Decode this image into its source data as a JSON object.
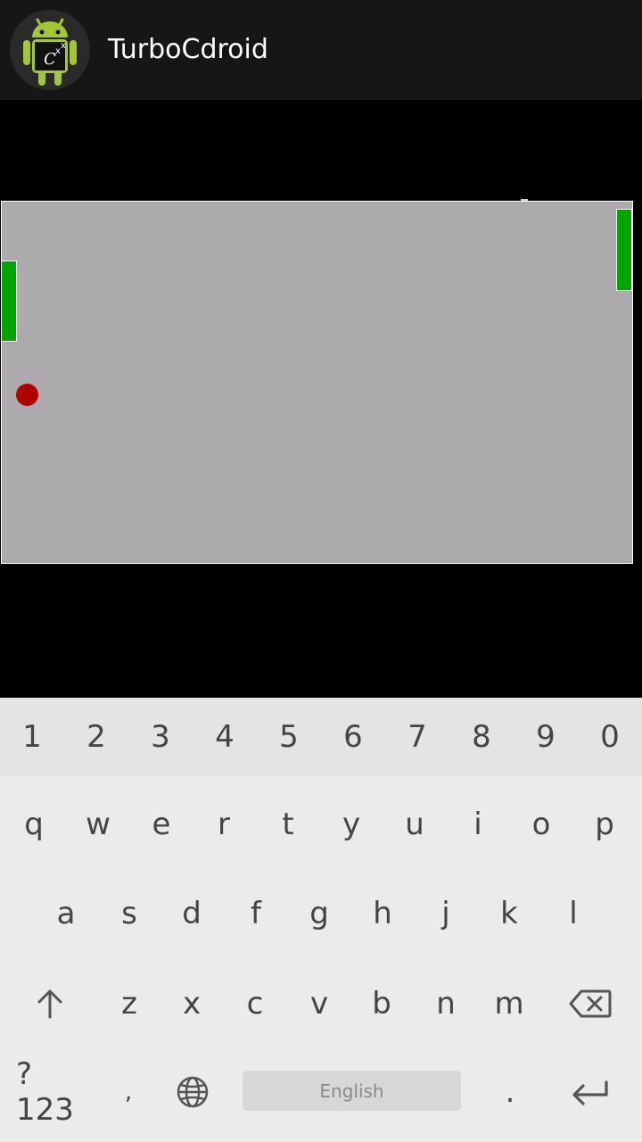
{
  "app": {
    "title": "TurboCdroid",
    "icon": "android-cxx-icon",
    "icon_text": "C^x^x"
  },
  "game": {
    "court_color": "#acaaad",
    "paddle_color": "#00a600",
    "ball_color": "#b00000"
  },
  "keyboard": {
    "number_row": [
      "1",
      "2",
      "3",
      "4",
      "5",
      "6",
      "7",
      "8",
      "9",
      "0"
    ],
    "row1": [
      "q",
      "w",
      "e",
      "r",
      "t",
      "y",
      "u",
      "i",
      "o",
      "p"
    ],
    "row2": [
      "a",
      "s",
      "d",
      "f",
      "g",
      "h",
      "j",
      "k",
      "l"
    ],
    "row3": [
      "z",
      "x",
      "c",
      "v",
      "b",
      "n",
      "m"
    ],
    "shift_icon": "shift-arrow-icon",
    "backspace_icon": "backspace-icon",
    "symbols_label": "?123",
    "comma_label": ",",
    "globe_icon": "globe-icon",
    "space_label": "English",
    "period_label": ".",
    "enter_icon": "enter-icon"
  }
}
